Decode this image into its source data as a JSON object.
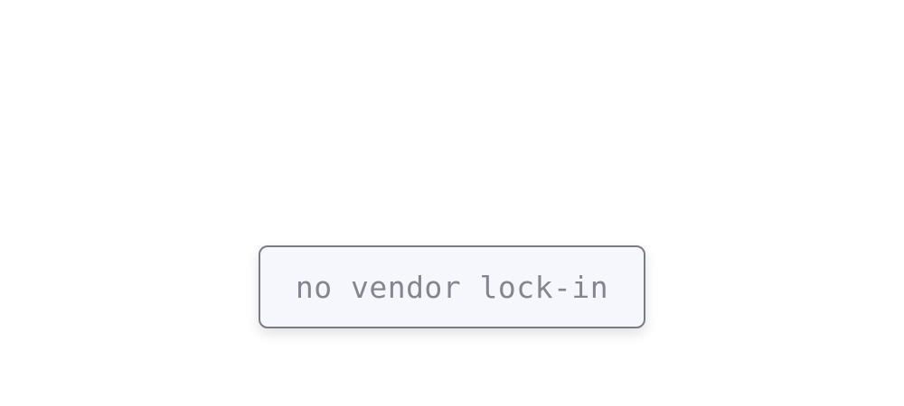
{
  "tag": {
    "label": "no vendor lock-in"
  },
  "colors": {
    "background": "#ffffff",
    "pill_background": "#f6f7fc",
    "pill_border": "#7b7b83",
    "text": "#85858f"
  }
}
